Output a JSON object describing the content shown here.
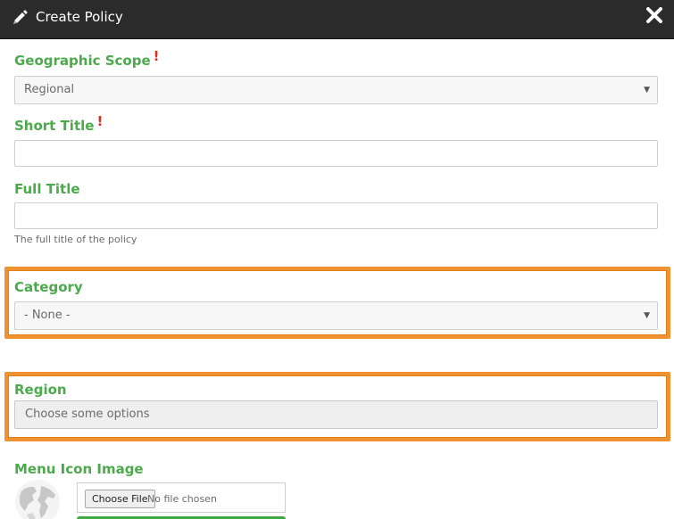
{
  "dialog": {
    "title": "Create Policy",
    "icon": "pencil-icon",
    "close_icon": "close-icon"
  },
  "fields": {
    "geographic_scope": {
      "label": "Geographic Scope",
      "required_mark": "!",
      "value": "Regional"
    },
    "short_title": {
      "label": "Short Title",
      "required_mark": "!",
      "value": ""
    },
    "full_title": {
      "label": "Full Title",
      "value": "",
      "help": "The full title of the policy"
    },
    "category": {
      "label": "Category",
      "value": "- None -"
    },
    "region": {
      "label": "Region",
      "placeholder": "Choose some options"
    },
    "menu_icon_image": {
      "label": "Menu Icon Image",
      "thumbnail_icon": "globe-icon",
      "choose_button": "Choose File",
      "file_status": "No file chosen"
    }
  },
  "colors": {
    "label_green": "#4caa4c",
    "required_red": "#d9311f",
    "highlight_orange": "#f0922f",
    "titlebar_bg": "#2b2b2b"
  }
}
